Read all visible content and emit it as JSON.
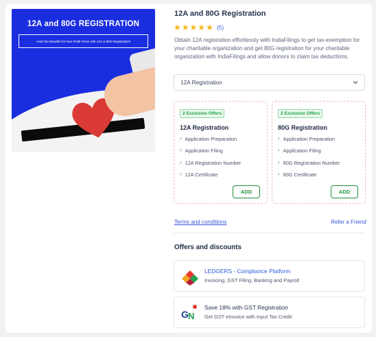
{
  "hero": {
    "title": "12A and 80G REGISTRATION",
    "subtitle": "Avail Tax Benefits for Non-Profit Firms with 12A & 80G Registration!"
  },
  "product": {
    "title": "12A and 80G Registration",
    "rating_stars": 5,
    "rating_count": "(5)",
    "description": "Obtain 12A registration effortlessly with IndiaFilings to get tax-exemption for your charitable organization and get 80G registration for your charitable organization with IndiaFilings and allow donors to claim tax deductions.",
    "selected_option": "12A Registration"
  },
  "plans": [
    {
      "badge": "2 Exclusive Offers",
      "title": "12A Registration",
      "features": [
        "Application Preparation",
        "Application Filing",
        "12A Registration Number",
        "12A Certificate"
      ],
      "add_label": "ADD"
    },
    {
      "badge": "2 Exclusive Offers",
      "title": "80G Registration",
      "features": [
        "Application Preparation",
        "Application Filing",
        "80G Registration Number",
        "80G Certificate"
      ],
      "add_label": "ADD"
    }
  ],
  "links": {
    "terms": "Terms and conditions",
    "refer": "Refer a Friend"
  },
  "offers": {
    "title": "Offers and discounts",
    "items": [
      {
        "title": "LEDGERS - Compliance Platform",
        "subtitle": "Invoicing, GST Filing, Banking and Payroll",
        "icon": "ledgers-logo-icon"
      },
      {
        "title": "Save 18% with GST Registration",
        "subtitle": "Get GST eInvoice with Input Tax Credit",
        "icon": "gst-logo-icon"
      }
    ]
  },
  "colors": {
    "hero_blue": "#1a2ee0",
    "link_blue": "#3356d6",
    "star_gold": "#f4b51c",
    "add_green": "#1f8f3c",
    "badge_green": "#1e9e45"
  }
}
